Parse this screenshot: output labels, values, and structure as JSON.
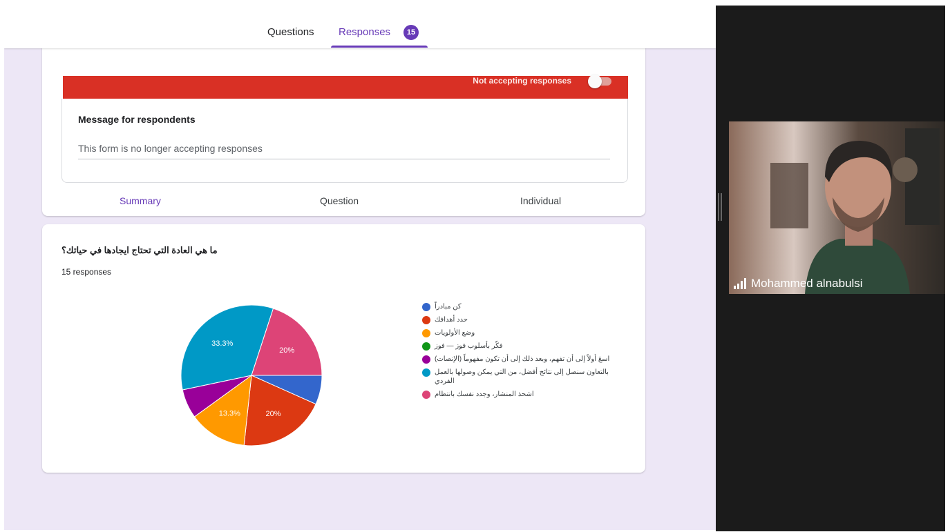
{
  "topbar": {
    "tabs": [
      "Questions",
      "Responses"
    ],
    "responses_badge": "15"
  },
  "responses_panel": {
    "accepting_label": "Not accepting responses",
    "accepting": false,
    "message_label": "Message for respondents",
    "message_value": "This form is no longer accepting responses"
  },
  "sub_tabs": [
    "Summary",
    "Question",
    "Individual"
  ],
  "question": {
    "title": "ما هي العادة التي تحتاج ايجادها في حياتك؟",
    "response_count": "15 responses"
  },
  "chart_data": {
    "type": "pie",
    "categories": [
      "كن مبادراً",
      "حدد أهدافك",
      "وضع الأولويات",
      "فكّر بأسلوب فوز — فوز",
      "اسعَ أولاً إلى أن تفهم، وبعد ذلك إلى أن تكون مفهوماً (الإنصات)",
      "بالتعاون سنصل إلى نتائج أفضل، من التي يمكن وصولها بالعمل الفردي",
      "اشحذ المنشار، وجدد نفسك بانتظام"
    ],
    "values": [
      6.7,
      20,
      13.3,
      0,
      6.7,
      33.3,
      20
    ],
    "slice_labels": [
      "",
      "20%",
      "13.3%",
      "",
      "",
      "33.3%",
      "20%"
    ],
    "colors": [
      "#3366cc",
      "#dc3912",
      "#ff9900",
      "#109618",
      "#990099",
      "#0099c6",
      "#dd4477"
    ],
    "legend_position": "right"
  },
  "video": {
    "participant_name": "Mohammed alnabulsi"
  }
}
